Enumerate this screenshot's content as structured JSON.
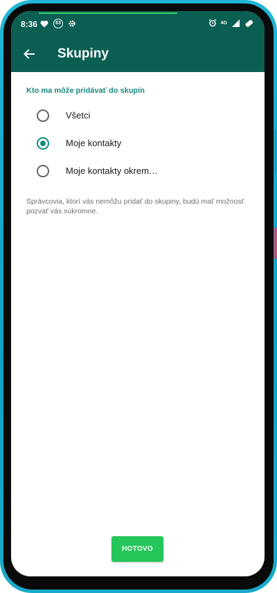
{
  "status_bar": {
    "time": "8:36",
    "badge_count": "63",
    "network_label": "4G",
    "icons": [
      "heart-icon",
      "notification-badge-icon",
      "settings-gear-icon",
      "alarm-icon",
      "signal-icon",
      "battery-icon"
    ]
  },
  "app_bar": {
    "title": "Skupiny",
    "back_icon": "arrow-left-icon"
  },
  "section": {
    "title": "Kto ma môže pridávať do skupín"
  },
  "options": [
    {
      "label": "Všetci",
      "checked": false
    },
    {
      "label": "Moje kontakty",
      "checked": true
    },
    {
      "label": "Moje kontakty okrem…",
      "checked": false
    }
  ],
  "note": "Správcovia, ktorí vás nemôžu pridať do skupiny, budú mať možnosť pozvať vás súkromne.",
  "done_button": {
    "label": "HOTOVO"
  },
  "colors": {
    "app_bar": "#0b5e52",
    "accent": "#128c7e",
    "section_title": "#1c8a7e",
    "button": "#25c65a",
    "frame": "#20b6d6"
  }
}
